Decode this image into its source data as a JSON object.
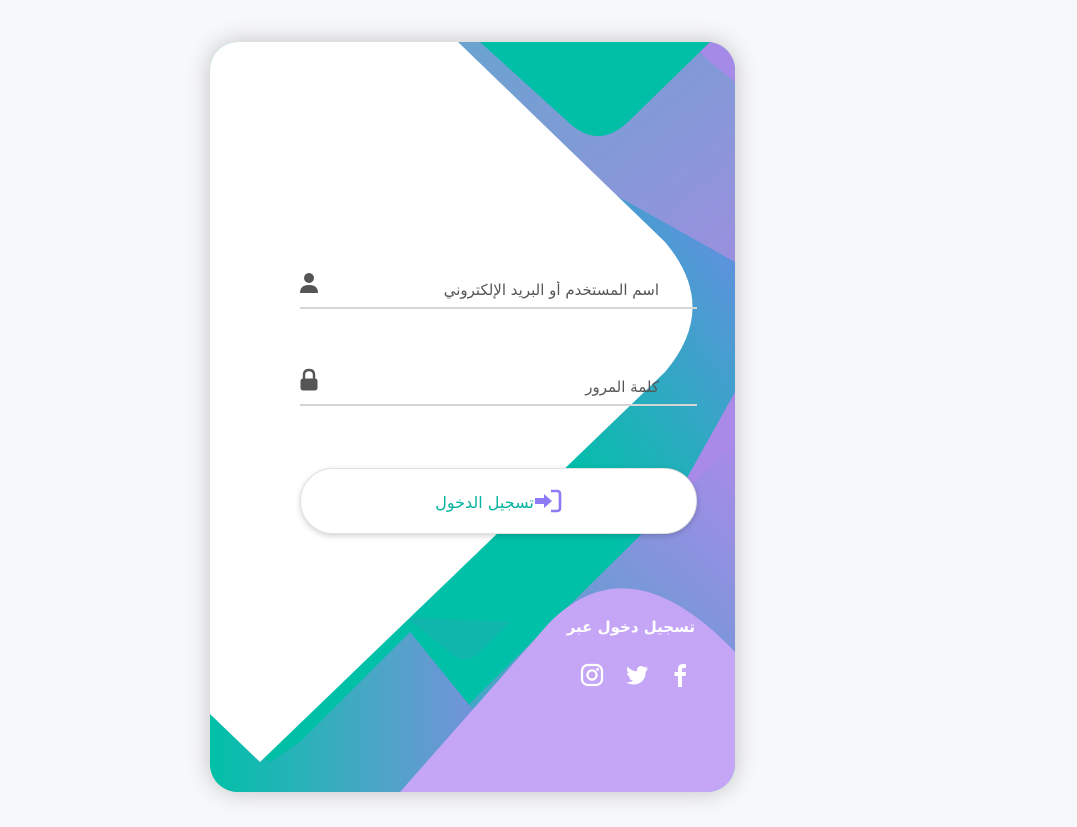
{
  "login_form": {
    "username_placeholder": "اسم المستخدم أو البريد الإلكتروني",
    "password_placeholder": "كلمة المرور",
    "submit_label": "تسجيل الدخول"
  },
  "social_login": {
    "title": "تسجيل دخول عبر",
    "networks": [
      "facebook-icon",
      "twitter-icon",
      "instagram-icon"
    ]
  },
  "icons": {
    "username": "user-icon",
    "password": "lock-icon",
    "submit": "sign-in-icon"
  },
  "colors": {
    "teal": "#00bfa6",
    "purple": "#8b7cf6",
    "lavender": "#c4a5f6",
    "accent_text": "#06b3a0"
  }
}
